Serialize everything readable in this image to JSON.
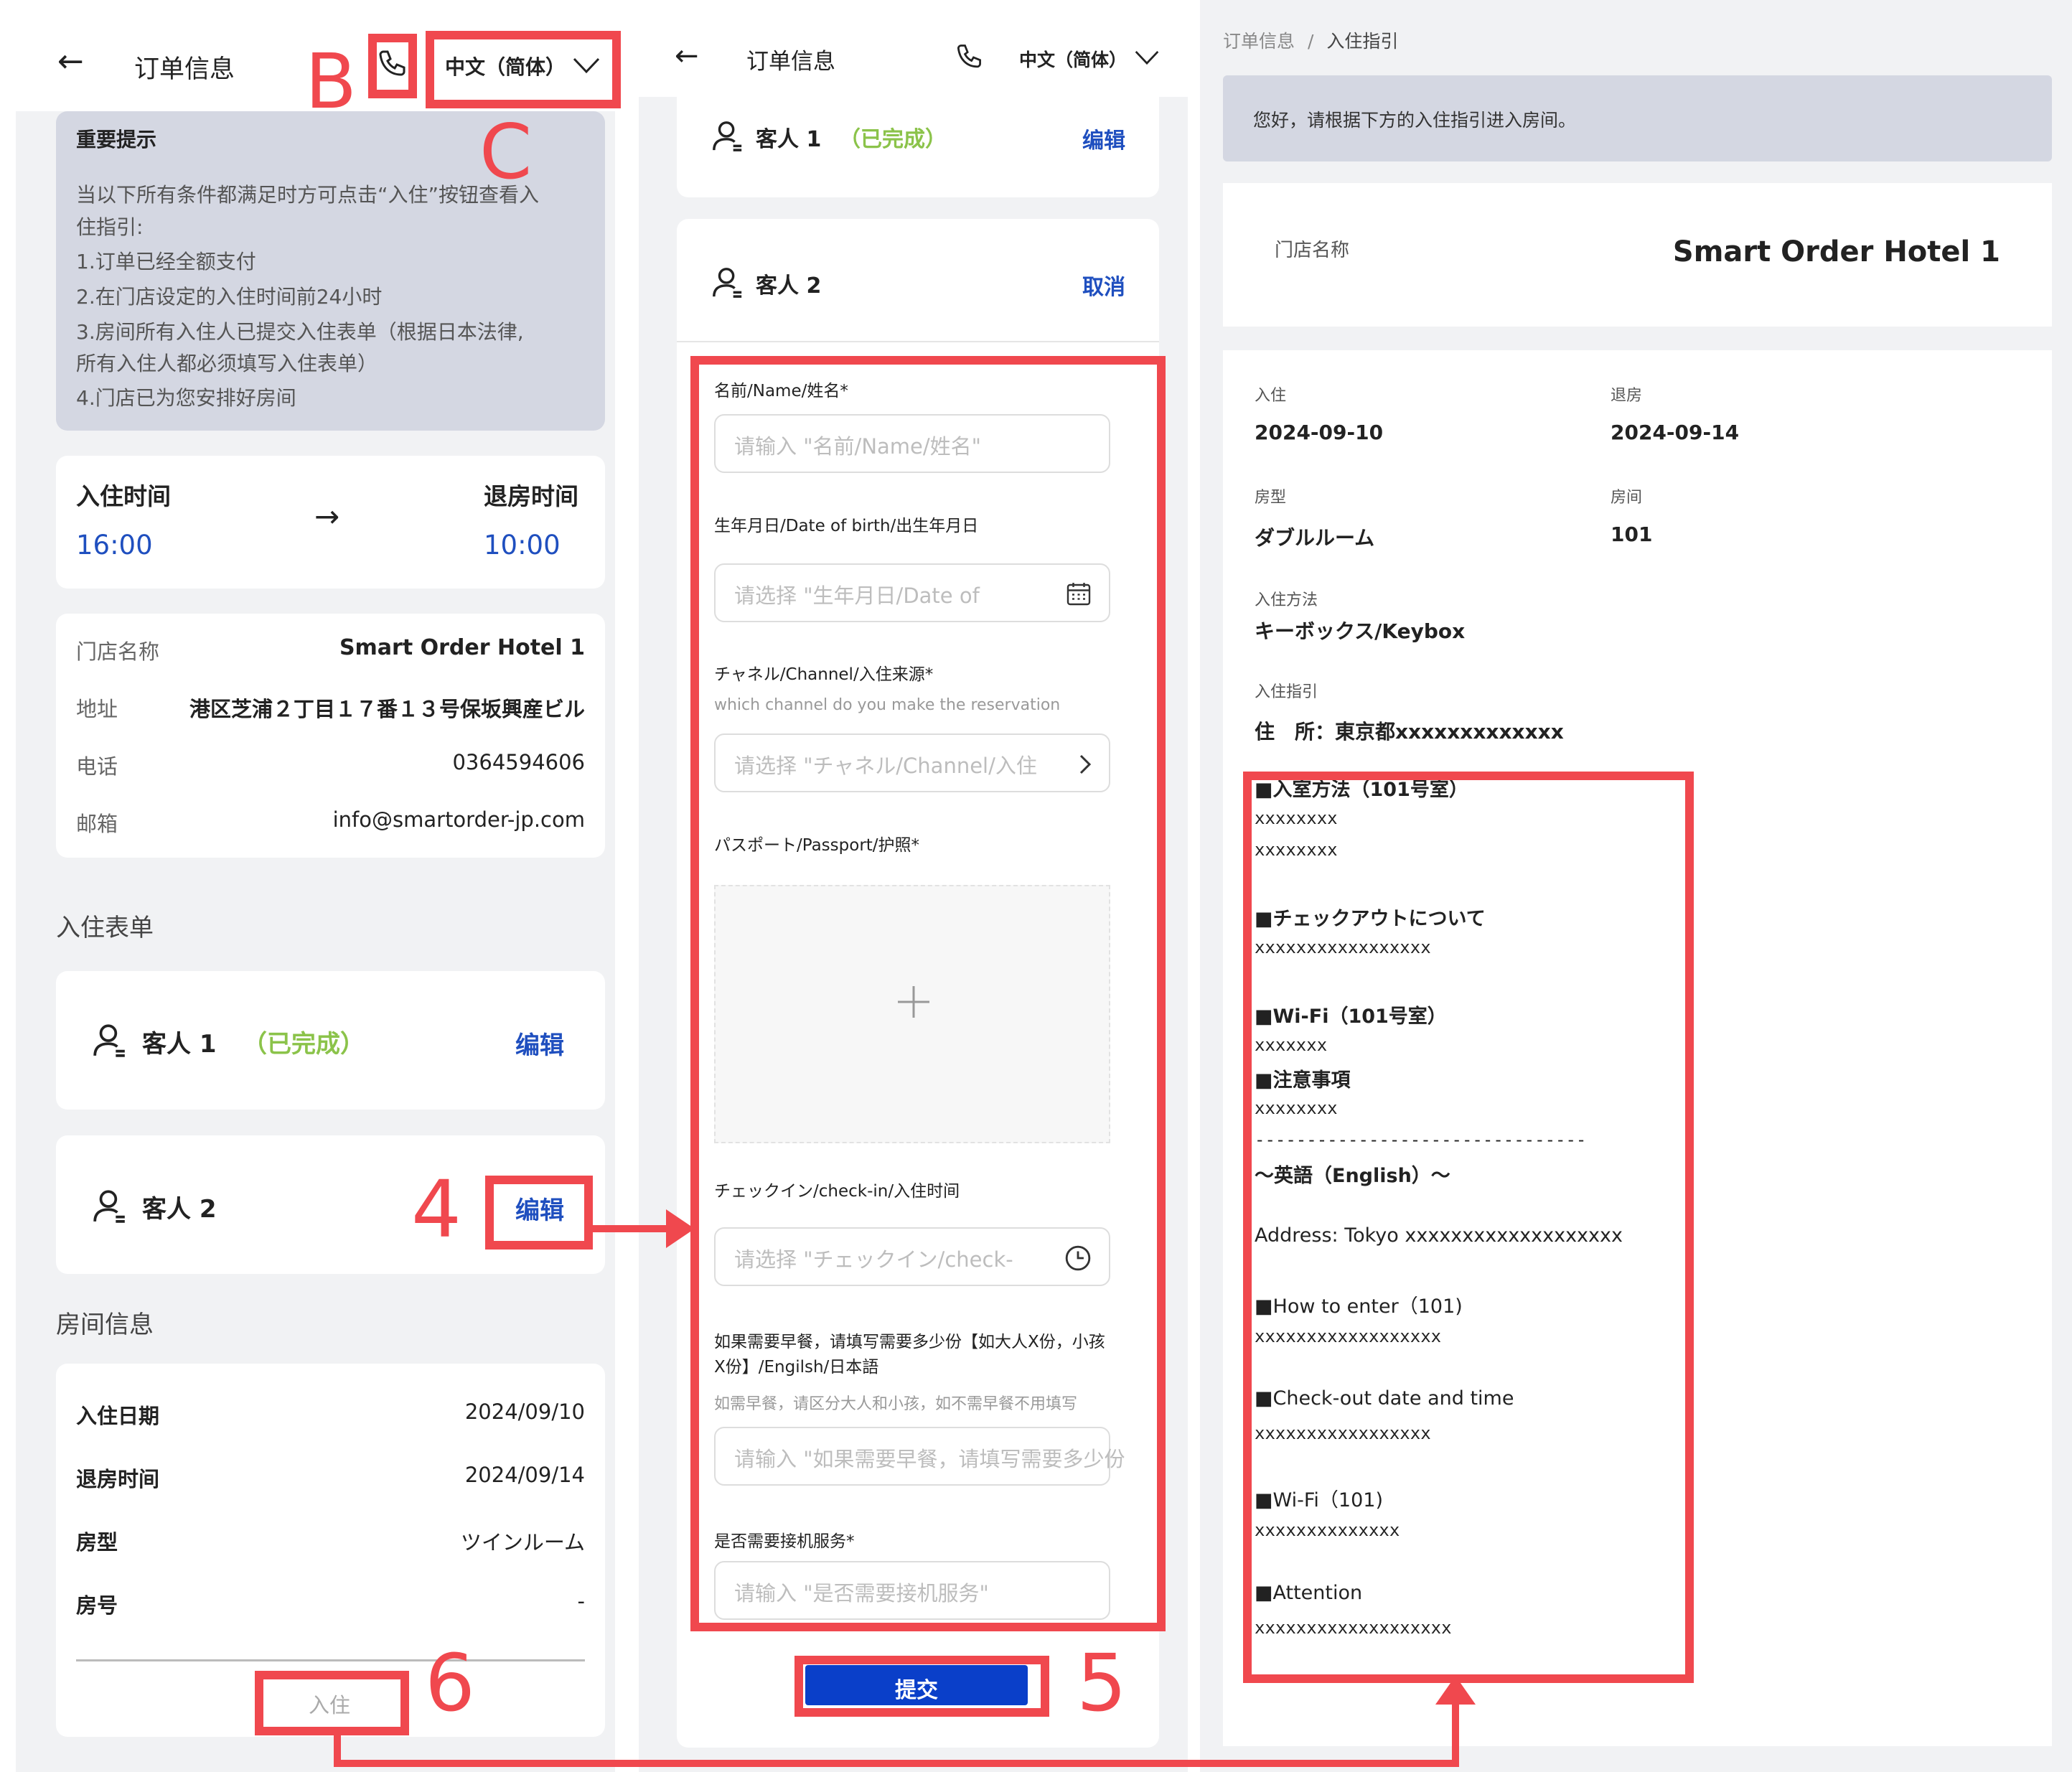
{
  "panel1": {
    "header": {
      "title": "订单信息",
      "lang": "中文（简体）"
    },
    "notice": {
      "title": "重要提示",
      "lines": [
        "当以下所有条件都满足时方可点击“入住”按钮查看入",
        "住指引:",
        "1.订单已经全额支付",
        "2.在门店设定的入住时间前24小时",
        "3.房间所有入住人已提交入住表单（根据日本法律,",
        "所有入住人都必须填写入住表单）",
        "4.门店已为您安排好房间"
      ]
    },
    "times": {
      "checkin_label": "入住时间",
      "checkin_value": "16:00",
      "checkout_label": "退房时间",
      "checkout_value": "10:00",
      "arrow": "→"
    },
    "hotel": {
      "name_label": "门店名称",
      "name_value": "Smart Order Hotel 1",
      "addr_label": "地址",
      "addr_value": "港区芝浦２丁目１７番１３号保坂興産ビル",
      "tel_label": "电话",
      "tel_value": "0364594606",
      "mail_label": "邮箱",
      "mail_value": "info@smartorder-jp.com"
    },
    "form_section": "入住表单",
    "guest1": {
      "label": "客人 1",
      "status": "（已完成）",
      "action": "编辑"
    },
    "guest2": {
      "label": "客人 2",
      "action": "编辑"
    },
    "room_section": "房间信息",
    "room": {
      "checkin_label": "入住日期",
      "checkin_value": "2024/09/10",
      "checkout_label": "退房时间",
      "checkout_value": "2024/09/14",
      "type_label": "房型",
      "type_value": "ツインルーム",
      "no_label": "房号",
      "no_value": "-"
    },
    "checkin_button": "入住"
  },
  "panel2": {
    "header": {
      "title": "订单信息",
      "lang": "中文（简体）"
    },
    "guest1": {
      "label": "客人 1",
      "status": "（已完成）",
      "action": "编辑"
    },
    "guest2": {
      "label": "客人 2",
      "action": "取消"
    },
    "fields": {
      "name_label": "名前/Name/姓名*",
      "name_ph": "请输入 \"名前/Name/姓名\"",
      "dob_label": "生年月日/Date of birth/出生年月日",
      "dob_ph": "请选择 \"生年月日/Date of",
      "channel_label": "チャネル/Channel/入住来源*",
      "channel_hint": "which channel do you make the reservation",
      "channel_ph": "请选择 \"チャネル/Channel/入住",
      "passport_label": "パスポート/Passport/护照*",
      "checkin_label": "チェックイン/check-in/入住时间",
      "checkin_ph": "请选择 \"チェックイン/check-",
      "breakfast_label1": "如果需要早餐，请填写需要多少份【如大人X份，小孩",
      "breakfast_label2": "X份】/Engilsh/日本語",
      "breakfast_hint": "如需早餐，请区分大人和小孩，如不需早餐不用填写",
      "breakfast_ph": "请输入 \"如果需要早餐，请填写需要多少份",
      "pickup_label": "是否需要接机服务*",
      "pickup_ph": "请输入 \"是否需要接机服务\""
    },
    "submit": "提交"
  },
  "panel3": {
    "breadcrumb": {
      "home": "订单信息",
      "sep": "/",
      "current": "入住指引"
    },
    "greeting": "您好，请根据下方的入住指引进入房间。",
    "hotel_label": "门店名称",
    "hotel_value": "Smart Order Hotel 1",
    "checkin_label": "入住",
    "checkin_value": "2024-09-10",
    "checkout_label": "退房",
    "checkout_value": "2024-09-14",
    "type_label": "房型",
    "type_value": "ダブルルーム",
    "room_label": "房间",
    "room_value": "101",
    "method_label": "入住方法",
    "method_value": "キーボックス/Keybox",
    "guide_label": "入住指引",
    "guide_addr": "住　所：東京都xxxxxxxxxxxxx",
    "guide": {
      "h1": "■入室方法（101号室）",
      "l1a": "xxxxxxxx",
      "l1b": "xxxxxxxx",
      "h2": "■チェックアウトについて",
      "l2": "xxxxxxxxxxxxxxxxx",
      "h3": "■Wi-Fi（101号室）",
      "l3": "xxxxxxx",
      "h4": "■注意事項",
      "l4": "xxxxxxxx",
      "sep": "--------------------------------",
      "en": "～英語（English）～",
      "addr": "Address: Tokyo xxxxxxxxxxxxxxxxxxx",
      "h5": "■How to enter（101)",
      "l5": "xxxxxxxxxxxxxxxxxx",
      "h6": "■Check-out date and time",
      "l6": "xxxxxxxxxxxxxxxxx",
      "h7": "■Wi-Fi（101)",
      "l7": "xxxxxxxxxxxxxx",
      "h8": "■Attention",
      "l8": "xxxxxxxxxxxxxxxxxxx"
    }
  },
  "annotations": {
    "b": "B",
    "c": "C",
    "n4": "4",
    "n5": "5",
    "n6": "6"
  },
  "colors": {
    "accent": "#1f4fbf",
    "done": "#8bc34a",
    "annotation": "#f0484e",
    "submit": "#0a3fc9"
  }
}
